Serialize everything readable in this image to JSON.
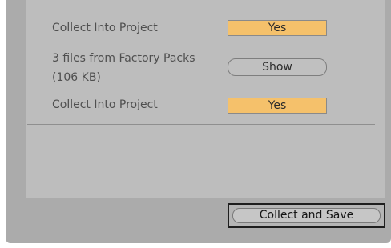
{
  "rows": [
    {
      "label": "Collect Into Project",
      "button": "Yes"
    },
    {
      "label_line1": "3 files from Factory Packs",
      "label_line2": "(106 KB)",
      "button": "Show"
    },
    {
      "label": "Collect Into Project",
      "button": "Yes"
    }
  ],
  "footer": {
    "save_label": "Collect and Save"
  },
  "colors": {
    "yes_button": "#f5c16b",
    "panel": "#bdbdbd",
    "window": "#ababab"
  }
}
